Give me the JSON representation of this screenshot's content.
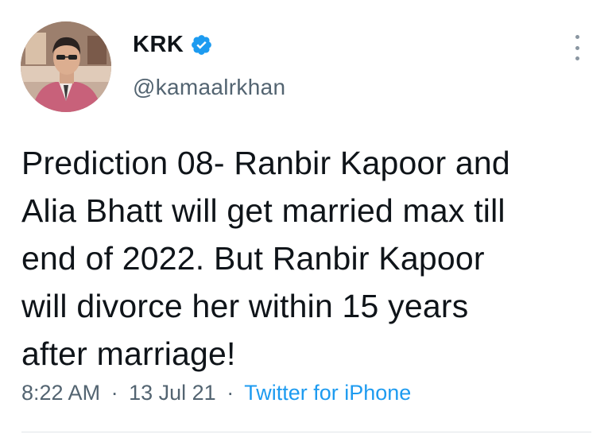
{
  "tweet": {
    "display_name": "KRK",
    "handle": "@kamaalrkhan",
    "verified_icon": "verified-badge-icon",
    "more_icon": "more-options-icon",
    "text": "Prediction 08- Ranbir Kapoor and\nAlia Bhatt will get married max till\nend of 2022. But Ranbir Kapoor\nwill divorce her within 15 years\nafter marriage!",
    "time": "8:22 AM",
    "separator": "·",
    "date": "13 Jul 21",
    "source": "Twitter for iPhone"
  },
  "colors": {
    "link": "#1d9bf0",
    "secondary_text": "#536471",
    "primary_text": "#0f1419",
    "verified_badge": "#1d9bf0"
  }
}
